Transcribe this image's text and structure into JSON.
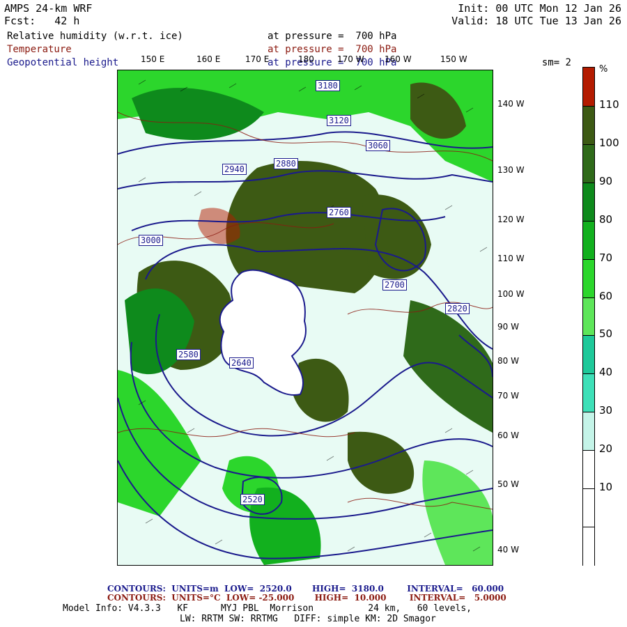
{
  "header": {
    "model": "AMPS 24-km WRF",
    "forecast": "Fcst:   42 h",
    "init": "Init: 00 UTC Mon 12 Jan 26",
    "valid": "Valid: 18 UTC Tue 13 Jan 26"
  },
  "fields": [
    {
      "name": "Relative humidity (w.r.t. ice)",
      "level": "at pressure =  700 hPa",
      "color": "#000000"
    },
    {
      "name": "Temperature",
      "level": "at pressure =  700 hPa",
      "color": "#8b1a10"
    },
    {
      "name": "Geopotential height",
      "level": "at pressure =  700 hPa",
      "color": "#1a1a8c"
    }
  ],
  "smoothing": "sm= 2",
  "lon_labels": [
    "150 E",
    "160 E",
    "170 E",
    "180",
    "170 W",
    "160 W",
    "150 W"
  ],
  "lat_labels": [
    "140 W",
    "130 W",
    "120 W",
    "110 W",
    "100 W",
    "90 W",
    "80 W",
    "70 W",
    "60 W",
    "50 W",
    "40 W"
  ],
  "colorbar": {
    "unit": "%",
    "labels": [
      "110",
      "100",
      "90",
      "80",
      "70",
      "60",
      "50",
      "40",
      "30",
      "20",
      "10"
    ],
    "colors": [
      "#b31b00",
      "#3d5a14",
      "#2f6a1a",
      "#0e8a1c",
      "#12b01e",
      "#2cd62c",
      "#5ee65a",
      "#1ec99a",
      "#3ee0b8",
      "#c4f4e8",
      "#ffffff",
      "#ffffff",
      "#ffffff"
    ]
  },
  "height_labels": [
    "3180",
    "3120",
    "3060",
    "3000",
    "2940",
    "2880",
    "2820",
    "2760",
    "2700",
    "2640",
    "2580",
    "2520"
  ],
  "footer": {
    "line1": "CONTOURS:  UNITS=m  LOW=  2520.0       HIGH=  3180.0        INTERVAL=   60.000",
    "line2": "CONTOURS:  UNITS=°C  LOW= -25.000       HIGH=  10.000        INTERVAL=   5.0000",
    "info1": "Model Info: V4.3.3   KF      MYJ PBL  Morrison          24 km,   60 levels,",
    "info2": "LW: RRTM SW: RRTMG   DIFF: simple KM: 2D Smagor"
  }
}
